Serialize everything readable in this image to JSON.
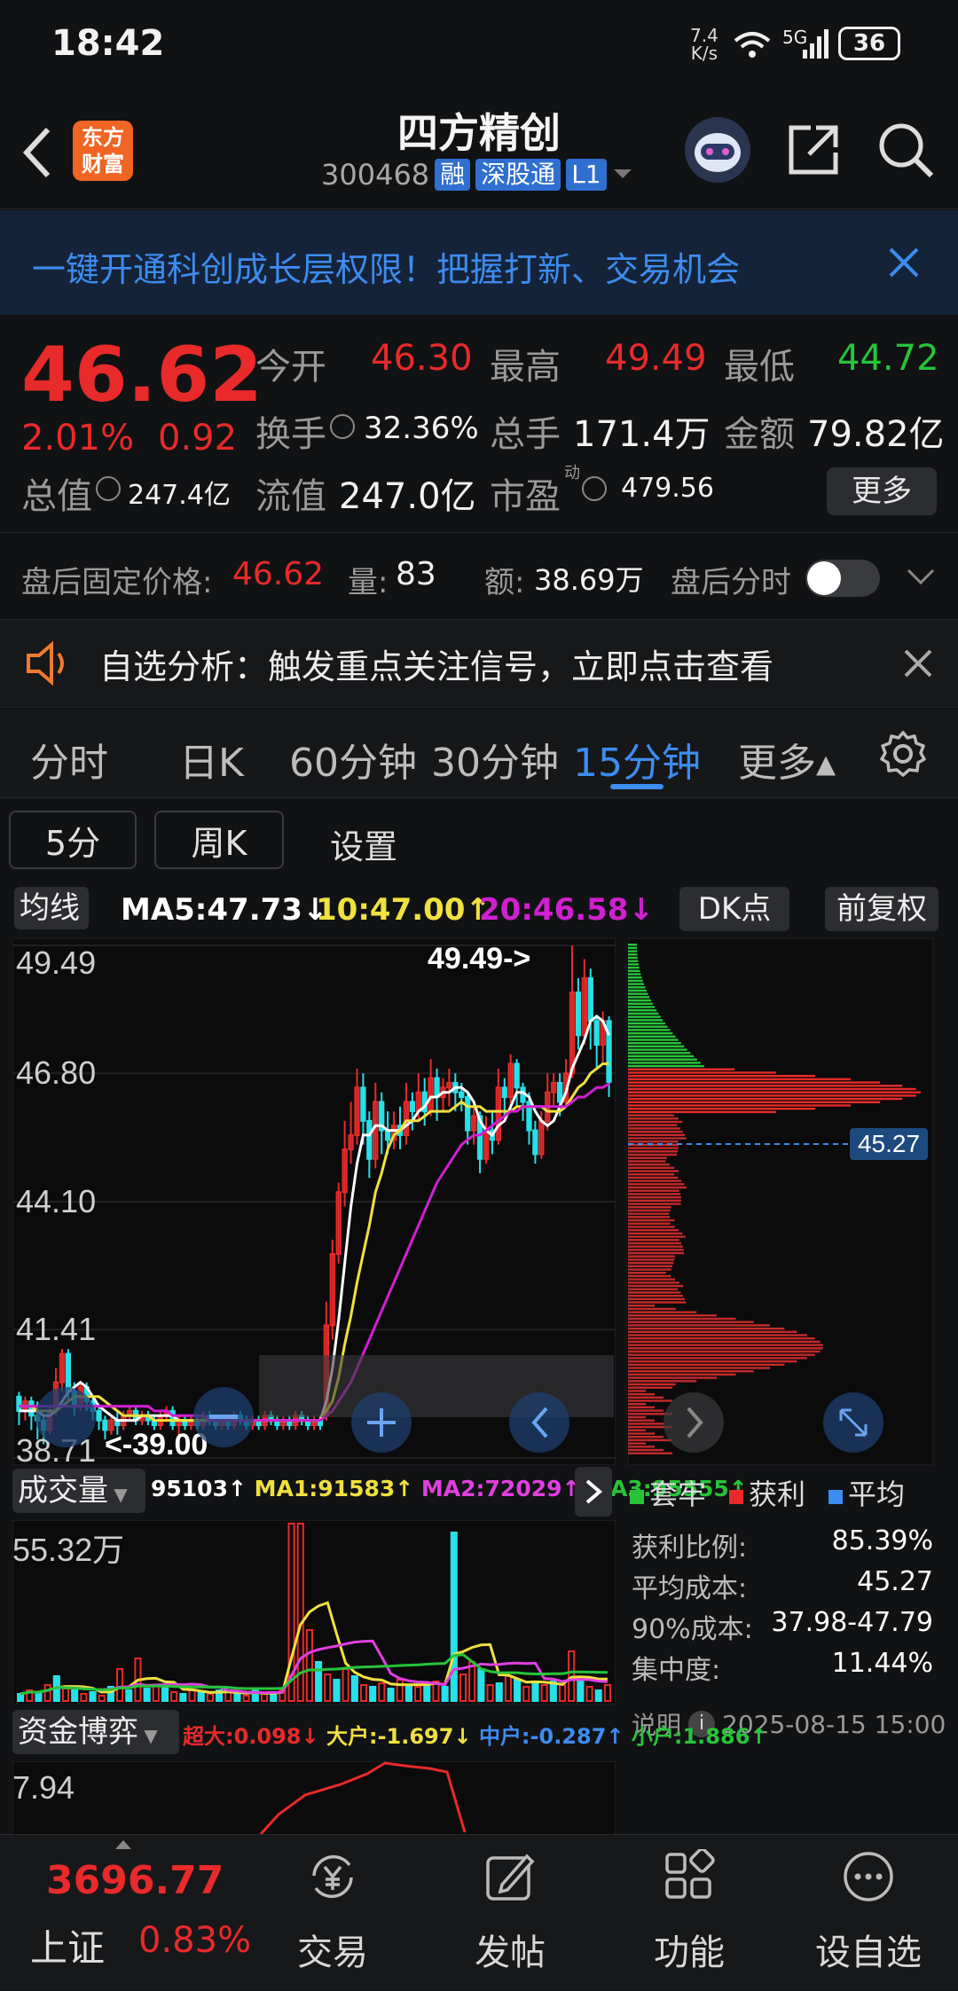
{
  "status": {
    "time": "18:42",
    "net_speed_top": "7.4",
    "net_speed_bottom": "K/s",
    "network": "5G",
    "battery": "36"
  },
  "header": {
    "title": "四方精创",
    "code": "300468",
    "badges": [
      "融",
      "深股通",
      "L1"
    ],
    "logo_line1": "东方",
    "logo_line2": "财富"
  },
  "banner": {
    "text": "一键开通科创成长层权限！把握打新、交易机会"
  },
  "quote": {
    "price": "46.62",
    "pct": "2.01%",
    "change": "0.92",
    "open_label": "今开",
    "open": "46.30",
    "high_label": "最高",
    "high": "49.49",
    "low_label": "最低",
    "low": "44.72",
    "turnover_label": "换手",
    "turnover": "32.36%",
    "volume_label": "总手",
    "volume": "171.4万",
    "amount_label": "金额",
    "amount": "79.82亿",
    "mcap_label": "总值",
    "mcap": "247.4亿",
    "float_label": "流值",
    "float": "247.0亿",
    "pe_label": "市盈",
    "pe_sup": "动",
    "pe": "479.56",
    "more": "更多"
  },
  "after_hours": {
    "price_label": "盘后固定价格:",
    "price": "46.62",
    "vol_label": "量:",
    "vol": "83",
    "amt_label": "额:",
    "amt": "38.69万",
    "toggle_label": "盘后分时"
  },
  "notice": {
    "text": "自选分析：触发重点关注信号，立即点击查看"
  },
  "tabs": [
    "分时",
    "日K",
    "60分钟",
    "30分钟",
    "15分钟",
    "更多▴"
  ],
  "active_tab": "15分钟",
  "subbuttons": [
    "5分",
    "周K",
    "设置"
  ],
  "ma_bar": {
    "label": "均线",
    "ma5": "MA5:47.73↓",
    "ma10": "10:47.00↑",
    "ma20": "20:46.58↓",
    "dk": "DK点",
    "fq": "前复权"
  },
  "chart_data": {
    "type": "candlestick",
    "y_ticks": [
      "49.49",
      "46.80",
      "44.10",
      "41.41",
      "38.71"
    ],
    "ylim": [
      38.71,
      49.49
    ],
    "high_marker": "49.49->",
    "low_marker": "<-39.00",
    "candles": [
      [
        40.0,
        39.7,
        40.1,
        39.4
      ],
      [
        39.7,
        39.9,
        40.0,
        39.5
      ],
      [
        39.9,
        39.6,
        40.0,
        39.3
      ],
      [
        39.6,
        39.5,
        39.9,
        39.1
      ],
      [
        39.5,
        39.3,
        39.6,
        39.0
      ],
      [
        39.3,
        39.7,
        39.8,
        39.2
      ],
      [
        39.7,
        40.3,
        40.6,
        39.6
      ],
      [
        40.3,
        40.9,
        41.0,
        40.1
      ],
      [
        40.9,
        40.1,
        41.0,
        39.9
      ],
      [
        40.1,
        39.8,
        40.3,
        39.6
      ],
      [
        39.8,
        40.2,
        40.3,
        39.7
      ],
      [
        40.2,
        39.9,
        40.3,
        39.7
      ],
      [
        39.9,
        39.7,
        40.0,
        39.5
      ],
      [
        39.7,
        39.5,
        39.8,
        39.3
      ],
      [
        39.5,
        39.3,
        39.6,
        39.1
      ],
      [
        39.3,
        39.5,
        39.6,
        39.2
      ],
      [
        39.5,
        39.4,
        39.7,
        39.2
      ],
      [
        39.4,
        39.6,
        39.7,
        39.3
      ],
      [
        39.6,
        39.7,
        39.8,
        39.5
      ],
      [
        39.7,
        39.5,
        39.8,
        39.4
      ],
      [
        39.5,
        39.6,
        39.7,
        39.4
      ],
      [
        39.6,
        39.5,
        39.7,
        39.4
      ],
      [
        39.5,
        39.4,
        39.6,
        39.3
      ],
      [
        39.4,
        39.6,
        39.7,
        39.3
      ],
      [
        39.6,
        39.7,
        39.8,
        39.5
      ],
      [
        39.7,
        39.4,
        39.8,
        39.3
      ],
      [
        39.4,
        39.5,
        39.6,
        39.2
      ],
      [
        39.5,
        39.4,
        39.6,
        39.3
      ],
      [
        39.4,
        39.5,
        39.6,
        39.3
      ],
      [
        39.5,
        39.4,
        39.6,
        39.3
      ],
      [
        39.4,
        39.6,
        39.7,
        39.3
      ],
      [
        39.6,
        39.5,
        39.7,
        39.4
      ],
      [
        39.5,
        39.4,
        39.6,
        39.3
      ],
      [
        39.4,
        39.5,
        39.6,
        39.3
      ],
      [
        39.5,
        39.4,
        39.6,
        39.3
      ],
      [
        39.4,
        39.6,
        39.7,
        39.3
      ],
      [
        39.6,
        39.5,
        39.7,
        39.4
      ],
      [
        39.5,
        39.4,
        39.6,
        39.3
      ],
      [
        39.4,
        39.5,
        39.6,
        39.3
      ],
      [
        39.5,
        39.4,
        39.6,
        39.3
      ],
      [
        39.4,
        39.6,
        39.7,
        39.3
      ],
      [
        39.6,
        39.5,
        39.7,
        39.4
      ],
      [
        39.5,
        39.4,
        39.6,
        39.3
      ],
      [
        39.4,
        39.5,
        39.6,
        39.3
      ],
      [
        39.5,
        39.4,
        39.6,
        39.3
      ],
      [
        39.4,
        39.6,
        39.7,
        39.3
      ],
      [
        39.6,
        39.5,
        39.7,
        39.4
      ],
      [
        39.5,
        39.4,
        39.6,
        39.3
      ],
      [
        39.4,
        39.5,
        39.6,
        39.3
      ],
      [
        39.5,
        39.4,
        39.6,
        39.3
      ],
      [
        39.6,
        41.5,
        42.0,
        39.5
      ],
      [
        41.5,
        43.0,
        43.3,
        41.2
      ],
      [
        43.0,
        44.3,
        44.5,
        42.8
      ],
      [
        44.3,
        45.2,
        45.8,
        44.0
      ],
      [
        45.2,
        45.5,
        46.2,
        44.9
      ],
      [
        45.5,
        46.5,
        46.9,
        45.3
      ],
      [
        46.5,
        45.8,
        46.8,
        45.3
      ],
      [
        45.8,
        45.0,
        46.0,
        44.6
      ],
      [
        45.0,
        46.2,
        46.6,
        44.8
      ],
      [
        46.2,
        45.6,
        46.4,
        45.1
      ],
      [
        45.6,
        45.4,
        46.0,
        45.1
      ],
      [
        45.4,
        45.7,
        46.0,
        45.2
      ],
      [
        45.7,
        45.5,
        46.1,
        45.2
      ],
      [
        45.5,
        46.2,
        46.6,
        45.3
      ],
      [
        46.2,
        46.0,
        46.4,
        45.6
      ],
      [
        46.0,
        46.4,
        46.8,
        45.8
      ],
      [
        46.4,
        46.0,
        46.7,
        45.7
      ],
      [
        46.0,
        46.7,
        47.1,
        45.9
      ],
      [
        46.7,
        46.3,
        46.9,
        45.8
      ],
      [
        46.3,
        46.5,
        46.7,
        46.0
      ],
      [
        46.5,
        46.6,
        46.9,
        46.1
      ],
      [
        46.6,
        46.4,
        46.8,
        46.0
      ],
      [
        46.4,
        46.3,
        46.6,
        46.0
      ],
      [
        46.3,
        45.6,
        46.4,
        45.3
      ],
      [
        45.6,
        45.9,
        46.2,
        45.3
      ],
      [
        45.9,
        45.0,
        46.0,
        44.7
      ],
      [
        45.0,
        45.6,
        45.9,
        44.9
      ],
      [
        45.6,
        45.4,
        46.0,
        45.1
      ],
      [
        45.4,
        46.5,
        46.9,
        45.3
      ],
      [
        46.5,
        46.3,
        46.7,
        45.9
      ],
      [
        46.3,
        47.0,
        47.2,
        46.1
      ],
      [
        47.0,
        46.5,
        47.1,
        46.1
      ],
      [
        46.5,
        46.2,
        46.6,
        45.8
      ],
      [
        46.2,
        45.6,
        46.4,
        45.3
      ],
      [
        45.6,
        45.1,
        45.8,
        44.9
      ],
      [
        45.1,
        45.8,
        46.0,
        45.0
      ],
      [
        45.8,
        46.4,
        46.8,
        45.6
      ],
      [
        46.4,
        46.6,
        46.8,
        46.1
      ],
      [
        46.6,
        46.2,
        46.8,
        45.9
      ],
      [
        46.2,
        46.8,
        47.1,
        46.1
      ],
      [
        46.8,
        48.5,
        49.49,
        46.7
      ],
      [
        48.5,
        47.6,
        48.8,
        47.3
      ],
      [
        47.6,
        48.8,
        49.2,
        47.4
      ],
      [
        48.8,
        47.9,
        49.0,
        47.3
      ],
      [
        47.9,
        47.4,
        48.0,
        46.9
      ],
      [
        47.4,
        47.9,
        48.1,
        47.0
      ],
      [
        47.9,
        46.62,
        48.0,
        46.3
      ]
    ],
    "ma5": [
      39.7,
      39.7,
      39.7,
      39.7,
      39.6,
      39.6,
      39.7,
      39.9,
      40.1,
      40.2,
      40.3,
      40.2,
      40.0,
      39.8,
      39.7,
      39.6,
      39.5,
      39.5,
      39.5,
      39.5,
      39.6,
      39.6,
      39.6,
      39.6,
      39.6,
      39.6,
      39.5,
      39.5,
      39.5,
      39.5,
      39.5,
      39.5,
      39.5,
      39.5,
      39.5,
      39.5,
      39.5,
      39.5,
      39.5,
      39.5,
      39.5,
      39.5,
      39.5,
      39.5,
      39.5,
      39.5,
      39.5,
      39.5,
      39.5,
      39.5,
      39.9,
      40.6,
      41.6,
      42.8,
      44.0,
      44.9,
      45.5,
      45.5,
      45.7,
      45.7,
      45.6,
      45.6,
      45.6,
      45.7,
      45.8,
      46.0,
      46.1,
      46.3,
      46.3,
      46.4,
      46.4,
      46.5,
      46.5,
      46.4,
      46.2,
      45.8,
      45.6,
      45.5,
      45.7,
      45.8,
      46.1,
      46.4,
      46.4,
      46.3,
      46.0,
      45.8,
      45.7,
      45.8,
      46.1,
      46.4,
      46.9,
      47.2,
      47.5,
      47.9,
      48.0,
      47.9,
      47.6
    ],
    "ma10": [
      39.8,
      39.8,
      39.8,
      39.7,
      39.7,
      39.7,
      39.7,
      39.8,
      39.9,
      40.0,
      40.0,
      40.0,
      40.0,
      40.0,
      39.9,
      39.8,
      39.7,
      39.6,
      39.6,
      39.6,
      39.6,
      39.6,
      39.5,
      39.5,
      39.5,
      39.5,
      39.5,
      39.5,
      39.5,
      39.5,
      39.5,
      39.5,
      39.5,
      39.5,
      39.5,
      39.5,
      39.5,
      39.5,
      39.5,
      39.5,
      39.5,
      39.5,
      39.5,
      39.5,
      39.5,
      39.5,
      39.5,
      39.5,
      39.5,
      39.5,
      39.7,
      39.9,
      40.4,
      41.1,
      41.7,
      42.4,
      43.0,
      43.6,
      44.3,
      44.7,
      45.2,
      45.5,
      45.6,
      45.8,
      45.8,
      45.8,
      45.9,
      46.0,
      46.0,
      46.0,
      46.0,
      46.1,
      46.2,
      46.1,
      46.1,
      46.1,
      46.0,
      46.0,
      46.0,
      46.0,
      46.0,
      46.1,
      46.1,
      46.1,
      46.1,
      46.1,
      46.0,
      46.0,
      46.0,
      46.1,
      46.3,
      46.5,
      46.6,
      46.8,
      46.9,
      47.0,
      47.0
    ],
    "ma20": [
      39.8,
      39.8,
      39.8,
      39.8,
      39.8,
      39.8,
      39.8,
      39.8,
      39.8,
      39.8,
      39.8,
      39.8,
      39.8,
      39.8,
      39.8,
      39.8,
      39.8,
      39.8,
      39.8,
      39.8,
      39.8,
      39.8,
      39.7,
      39.7,
      39.7,
      39.6,
      39.6,
      39.6,
      39.6,
      39.6,
      39.6,
      39.5,
      39.5,
      39.5,
      39.5,
      39.5,
      39.5,
      39.5,
      39.5,
      39.5,
      39.5,
      39.5,
      39.5,
      39.5,
      39.5,
      39.5,
      39.5,
      39.5,
      39.5,
      39.5,
      39.6,
      39.7,
      39.9,
      40.1,
      40.3,
      40.6,
      40.9,
      41.2,
      41.5,
      41.8,
      42.1,
      42.4,
      42.7,
      43.0,
      43.3,
      43.6,
      43.9,
      44.2,
      44.5,
      44.7,
      44.9,
      45.1,
      45.3,
      45.4,
      45.5,
      45.5,
      45.6,
      45.7,
      45.8,
      45.9,
      46.0,
      46.0,
      46.1,
      46.1,
      46.1,
      46.1,
      46.1,
      46.1,
      46.1,
      46.1,
      46.2,
      46.3,
      46.3,
      46.4,
      46.5,
      46.5,
      46.58
    ]
  },
  "chip": {
    "cost_marker": "45.27",
    "legend": [
      "套牢",
      "获利",
      "平均"
    ],
    "rows": [
      [
        "获利比例:",
        "85.39%"
      ],
      [
        "平均成本:",
        "45.27"
      ],
      [
        "90%成本:",
        "37.98-47.79"
      ],
      [
        "集中度:",
        "11.44%"
      ]
    ],
    "note": "说明",
    "date": "2025-08-15 15:00"
  },
  "volume": {
    "label": "成交量",
    "value": "95103↑",
    "ma1": "MA1:91583↑",
    "ma2": "MA2:72029↑",
    "ma3": "MA3:95555↑",
    "max": "55.32万",
    "bars": [
      [
        4,
        1
      ],
      [
        6,
        0
      ],
      [
        5,
        1
      ],
      [
        9,
        0
      ],
      [
        14,
        1
      ],
      [
        7,
        0
      ],
      [
        6,
        1
      ],
      [
        4,
        0
      ],
      [
        5,
        1
      ],
      [
        3,
        0
      ],
      [
        8,
        1
      ],
      [
        18,
        0
      ],
      [
        6,
        1
      ],
      [
        24,
        0
      ],
      [
        7,
        1
      ],
      [
        9,
        0
      ],
      [
        8,
        1
      ],
      [
        5,
        0
      ],
      [
        4,
        1
      ],
      [
        6,
        0
      ],
      [
        5,
        1
      ],
      [
        4,
        0
      ],
      [
        6,
        1
      ],
      [
        5,
        0
      ],
      [
        4,
        1
      ],
      [
        3,
        0
      ],
      [
        6,
        1
      ],
      [
        4,
        0
      ],
      [
        5,
        1
      ],
      [
        6,
        0
      ],
      [
        100,
        0
      ],
      [
        100,
        0
      ],
      [
        40,
        0
      ],
      [
        22,
        1
      ],
      [
        15,
        0
      ],
      [
        12,
        1
      ],
      [
        18,
        0
      ],
      [
        14,
        1
      ],
      [
        9,
        0
      ],
      [
        8,
        1
      ],
      [
        10,
        0
      ],
      [
        7,
        1
      ],
      [
        12,
        0
      ],
      [
        9,
        1
      ],
      [
        8,
        0
      ],
      [
        10,
        1
      ],
      [
        11,
        0
      ],
      [
        8,
        1
      ],
      [
        95,
        1
      ],
      [
        15,
        0
      ],
      [
        22,
        0
      ],
      [
        18,
        1
      ],
      [
        9,
        0
      ],
      [
        10,
        1
      ],
      [
        14,
        0
      ],
      [
        12,
        1
      ],
      [
        8,
        0
      ],
      [
        10,
        1
      ],
      [
        9,
        0
      ],
      [
        11,
        1
      ],
      [
        9,
        0
      ],
      [
        28,
        0
      ],
      [
        11,
        1
      ],
      [
        8,
        0
      ],
      [
        6,
        1
      ],
      [
        9,
        0
      ]
    ]
  },
  "flow": {
    "label": "资金博弈",
    "super": "超大:0.098↓",
    "big": "大户:-1.697↓",
    "mid": "中户:-0.287↑",
    "small": "小户:1.886↑",
    "max": "7.94"
  },
  "bottom": {
    "index_value": "3696.77",
    "index_name": "上证",
    "index_pct": "0.83%",
    "nav": [
      "交易",
      "发帖",
      "功能",
      "设自选"
    ]
  },
  "colors": {
    "up": "#e82a2a",
    "down": "#27e0e8",
    "accent": "#3d8cf0",
    "ma5": "#ffffff",
    "ma10": "#f0e040",
    "ma20": "#d020d0"
  }
}
